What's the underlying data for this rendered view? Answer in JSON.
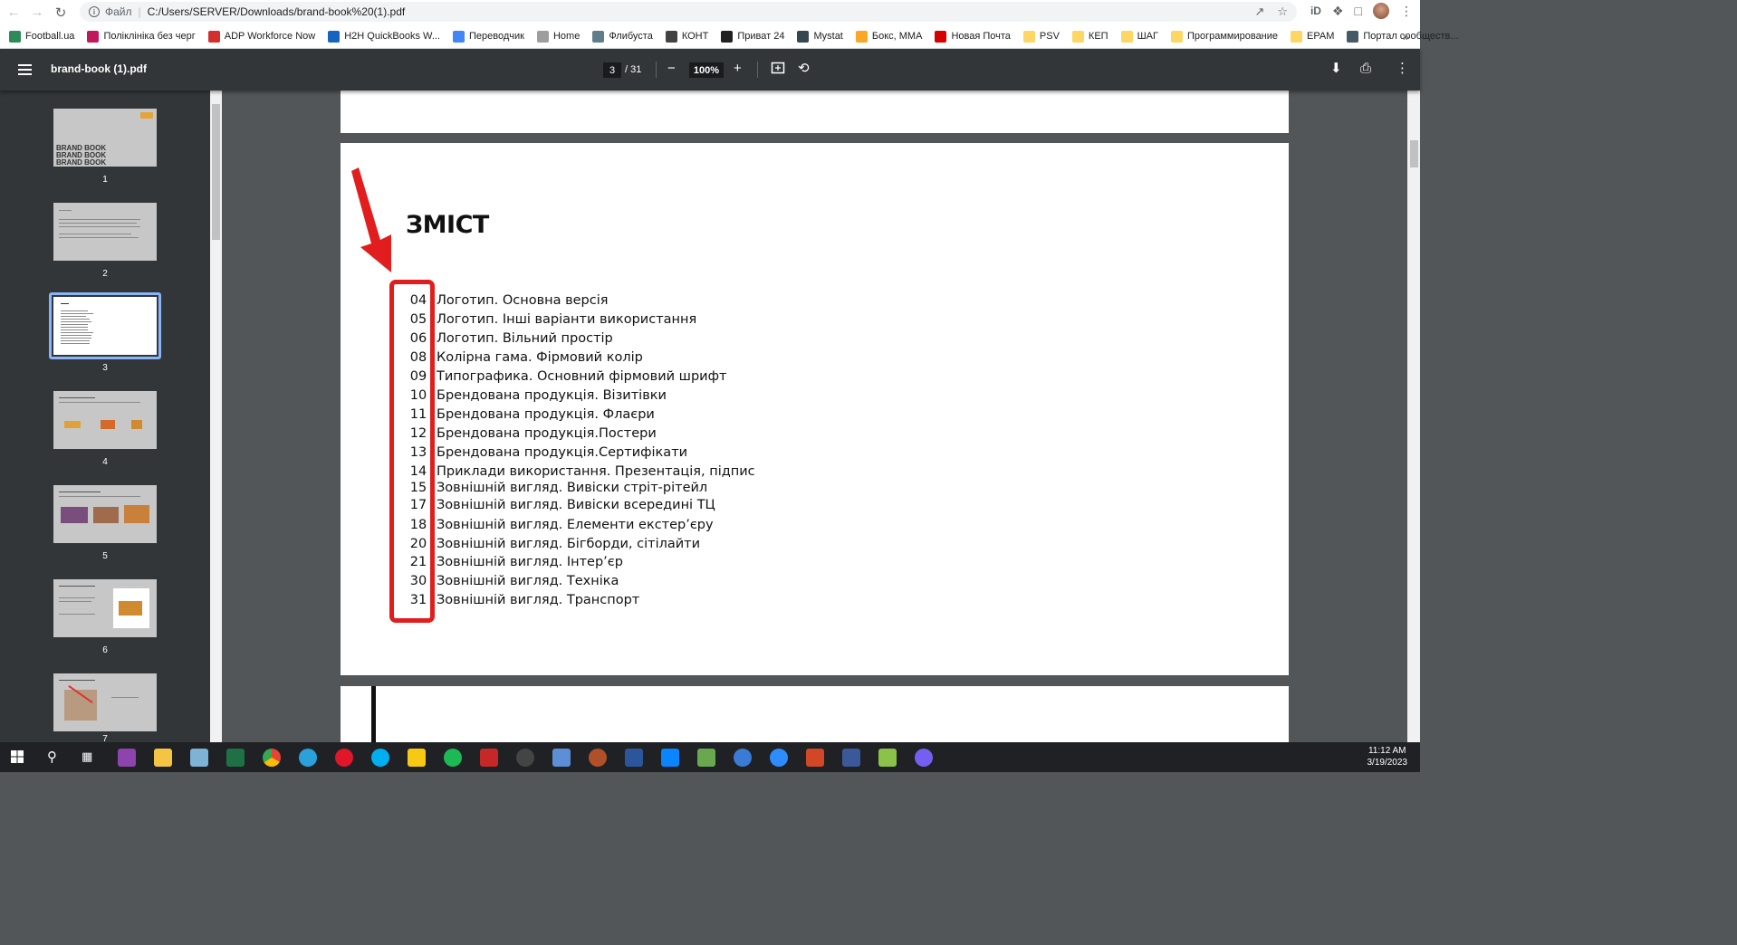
{
  "browser": {
    "scheme": "Файл",
    "url": "C:/Users/SERVER/Downloads/brand-book%20(1).pdf"
  },
  "bookmarks": [
    {
      "label": "Football.ua",
      "icon": "football-icon",
      "color": "#2e8b57"
    },
    {
      "label": "Поліклініка без черг",
      "icon": "flower-icon",
      "color": "#c2185b"
    },
    {
      "label": "ADP Workforce Now",
      "icon": "adp-icon",
      "color": "#d32f2f"
    },
    {
      "label": "H2H QuickBooks W...",
      "icon": "globe-icon",
      "color": "#1565c0"
    },
    {
      "label": "Переводчик",
      "icon": "translate-icon",
      "color": "#4285f4"
    },
    {
      "label": "Home",
      "icon": "home-icon",
      "color": "#9e9e9e"
    },
    {
      "label": "Флибуста",
      "icon": "book-icon",
      "color": "#607d8b"
    },
    {
      "label": "КОНТ",
      "icon": "kont-icon",
      "color": "#424242"
    },
    {
      "label": "Приват 24",
      "icon": "privat-icon",
      "color": "#212121"
    },
    {
      "label": "Mystat",
      "icon": "mortarboard-icon",
      "color": "#37474f"
    },
    {
      "label": "Бокс, ММА",
      "icon": "box-icon",
      "color": "#f9a825"
    },
    {
      "label": "Новая Почта",
      "icon": "novaposhta-icon",
      "color": "#d50000"
    },
    {
      "label": "PSV",
      "icon": "folder-icon",
      "color": "#fdd663"
    },
    {
      "label": "КЕП",
      "icon": "folder-icon",
      "color": "#fdd663"
    },
    {
      "label": "ШАГ",
      "icon": "folder-icon",
      "color": "#fdd663"
    },
    {
      "label": "Программирование",
      "icon": "folder-icon",
      "color": "#fdd663"
    },
    {
      "label": "EPAM",
      "icon": "folder-icon",
      "color": "#fdd663"
    },
    {
      "label": "Портал сообществ...",
      "icon": "portal-icon",
      "color": "#455a64"
    }
  ],
  "pdf": {
    "title": "brand-book (1).pdf",
    "current_page": "3",
    "total_pages": "/ 31",
    "zoom": "100%"
  },
  "thumbnails": [
    {
      "num": "1",
      "label_lines": [
        "BRAND BOOK",
        "BRAND BOOK",
        "BRAND BOOK"
      ]
    },
    {
      "num": "2"
    },
    {
      "num": "3"
    },
    {
      "num": "4"
    },
    {
      "num": "5"
    },
    {
      "num": "6"
    },
    {
      "num": "7"
    }
  ],
  "toc": {
    "title": "ЗМІСТ",
    "items": [
      {
        "num": "04",
        "text": "Логотип. Основна версія"
      },
      {
        "num": "05",
        "text": "Логотип. Інші варіанти використання"
      },
      {
        "num": "06",
        "text": "Логотип. Вільний простір"
      },
      {
        "num": "08",
        "text": "Колірна гама. Фірмовий колір"
      },
      {
        "num": "09",
        "text": "Типографика. Основний фірмовий шрифт"
      },
      {
        "num": "10",
        "text": "Брендована продукція. Візитівки"
      },
      {
        "num": "11",
        "text": "Брендована продукція. Флаєри"
      },
      {
        "num": "12",
        "text": "Брендована продукція.Постери"
      },
      {
        "num": "13",
        "text": "Брендована продукція.Сертифікати"
      },
      {
        "num": "14",
        "text": "Приклади використання. Презентація, підпис"
      },
      {
        "num": "15",
        "text": "Зовнішній вигляд. Вивіски стріт-рітейл"
      },
      {
        "num": "17",
        "text": "Зовнішній вигляд. Вивіски всередині ТЦ"
      },
      {
        "num": "18",
        "text": "Зовнішній вигляд. Елементи екстер’єру"
      },
      {
        "num": "20",
        "text": "Зовнішній вигляд.  Бігборди, сітілайти"
      },
      {
        "num": "21",
        "text": "Зовнішній вигляд. Інтер’єр"
      },
      {
        "num": "30",
        "text": "Зовнішній вигляд. Техніка"
      },
      {
        "num": "31",
        "text": "Зовнішній вигляд. Транспорт"
      }
    ]
  },
  "annotation_color": "#e11d1d",
  "taskbar": {
    "time": "11:12 AM",
    "date": "3/19/2023"
  }
}
